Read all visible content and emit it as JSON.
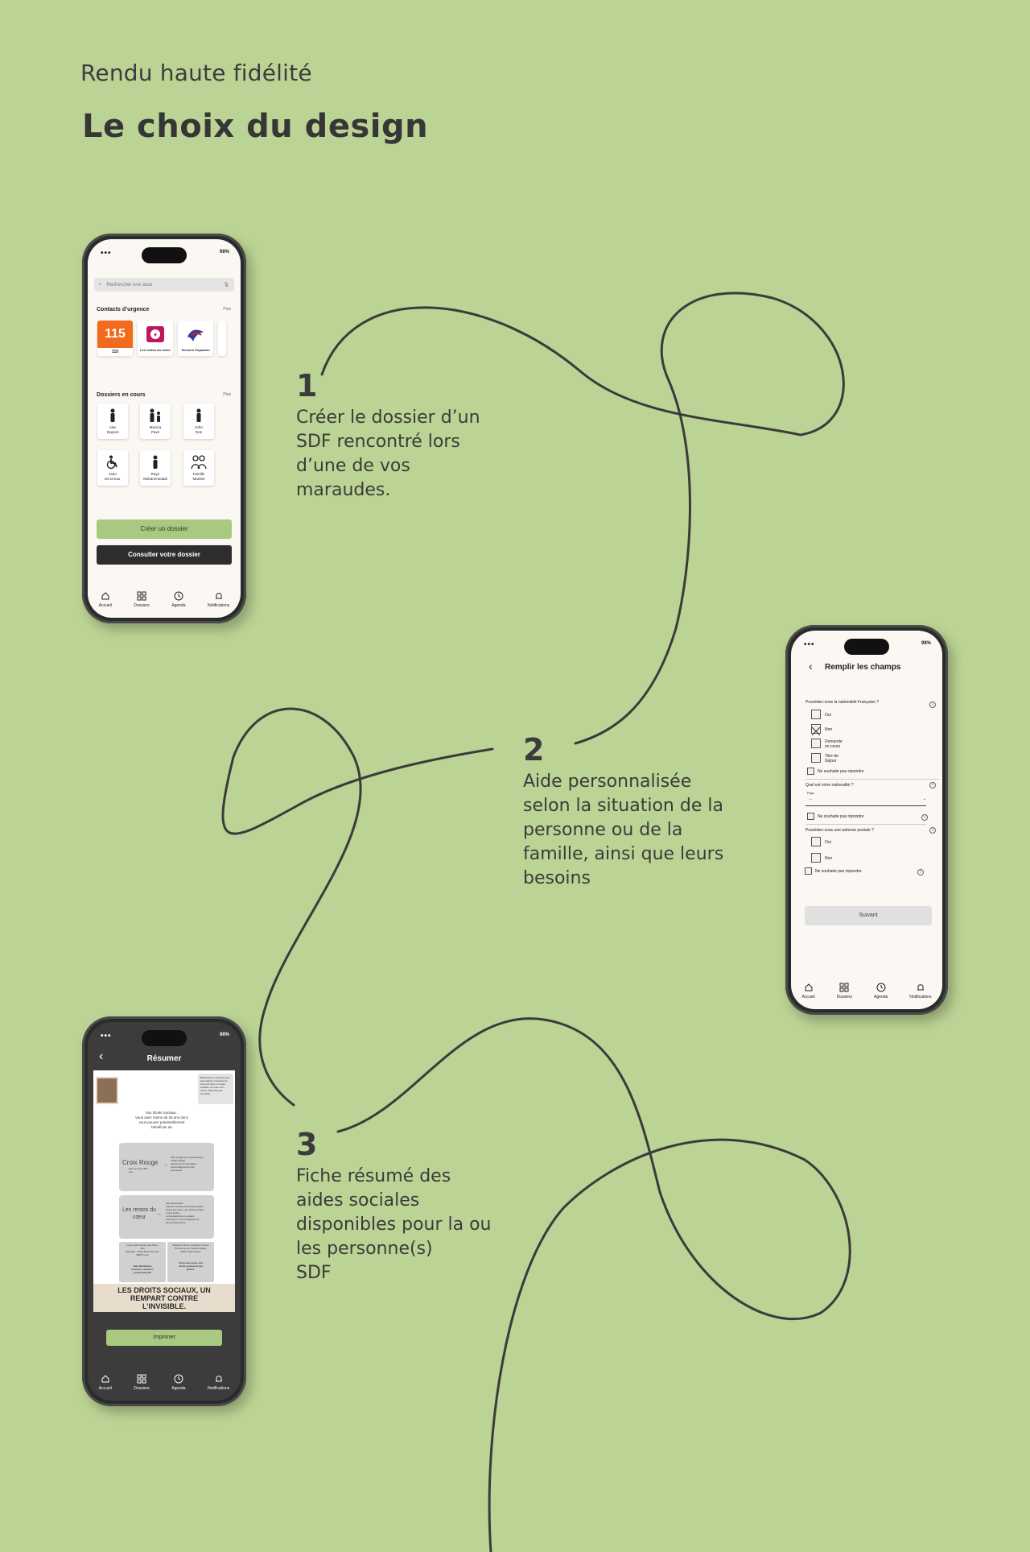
{
  "header": {
    "subtitle": "Rendu haute fidélité",
    "title": "Le choix du design"
  },
  "steps": [
    {
      "number": "1",
      "text": "Créer le dossier d’un\nSDF rencontré lors\nd’une de vos\nmaraudes."
    },
    {
      "number": "2",
      "text": "Aide personnalisée\nselon la situation de la\npersonne ou de la\nfamille, ainsi que leurs\nbesoins"
    },
    {
      "number": "3",
      "text": "Fiche résumé des\naides sociales\ndisponibles pour la ou\nles personne(s)\nSDF"
    }
  ],
  "status": {
    "battery": "98%"
  },
  "tabbar": [
    {
      "label": "Accueil",
      "icon": "home-icon"
    },
    {
      "label": "Dossiers",
      "icon": "grid-icon"
    },
    {
      "label": "Agenda",
      "icon": "clock-icon"
    },
    {
      "label": "Notifications",
      "icon": "bell-icon"
    }
  ],
  "phone1": {
    "search_placeholder": "Rechercher une asso",
    "contacts_title": "Contacts d’urgence",
    "more_label": "Plus",
    "contacts": [
      {
        "label": "115",
        "badge": "115",
        "color": "#f26a1b"
      },
      {
        "label": "Les restos du coeur"
      },
      {
        "label": "Secours Populaire"
      }
    ],
    "dossiers_title": "Dossiers en cours",
    "dossiers": [
      {
        "name": "Alex\nDupont",
        "icon": "person-icon"
      },
      {
        "name": "Monica\nPavir",
        "icon": "parent-child-icon"
      },
      {
        "name": "John\nDoe",
        "icon": "person-icon"
      },
      {
        "name": "Jean\nDe la tour",
        "icon": "wheelchair-icon"
      },
      {
        "name": "Rayn\nMohammedadi",
        "icon": "person-icon"
      },
      {
        "name": "Famille\nMartein",
        "icon": "family-icon"
      }
    ],
    "create_button": "Créer un dossier",
    "consult_button": "Consulter votre dossier"
  },
  "phone2": {
    "title": "Remplir les champs",
    "q1": "Possédez-vous la nationalité Française ?",
    "q1_options": [
      "Oui",
      "Non",
      "Demande\nen cours",
      "Titre de\nSéjour"
    ],
    "no_answer": "Ne souhaite pas répondre",
    "q2": "Quel est votre nationalité ?",
    "q2_field_label": "Pays",
    "q2_field_value": "...",
    "q3": "Possédez-vous une adresse postale ?",
    "q3_options": [
      "Oui",
      "Non"
    ],
    "next_button": "Suivant"
  },
  "phone3": {
    "title": "Résumer",
    "note": "Bénévoles et cuisiniers des associations présentes le soir pour faire un repas solidaire au cœur d’un centre d’accueil pour l’Invisible",
    "intro": "Vos Droits Sociaux :\nVous avez moins de 25 ans donc\nvous pouvez potentiellement\nbénéficier de",
    "org1": "Croix Rouge",
    "org1_sub": "plus ta deme ditle\nuse",
    "org1_desc": "Aide d’urgence et associations\nd’aide sociale\nActions pour information\nAccompagnement des\npersonnes",
    "org2": "Les restos du\ncœur",
    "org2_desc": "Aide alimentaire\nInsertion sociale et professionnelle\nAccès aux soins, aux droits sociaux\net à la justice\nAccompagnement scolaire\nFavoriser un accompagnement\naux activités libres",
    "org3_left": "Foyer Notre-Dame-des-Sans-\nAbri\nRefuges : 3 Rue Père Chevrier\n69007 Lyon",
    "org3_left_bold": "Aide alimentaire\nInsertion sociale et\nprofessionnelle",
    "org3_right": "Médecins Sans Frontières France\n64 avenue de l’Aubert-Sidaux\n69001 Saint-Denis",
    "org3_right_bold": "Accès aux soins, aux\ndroits sociaux et à la\njustice.",
    "banner": "LES DROITS SOCIAUX, UN\nREMPART CONTRE\nL’INVISIBLE.",
    "print_button": "Imprimer"
  },
  "colors": {
    "background": "#bbd394",
    "accent_green": "#a8c97f",
    "dark_button": "#2e2e2e",
    "emergency_orange": "#f26a1b"
  }
}
